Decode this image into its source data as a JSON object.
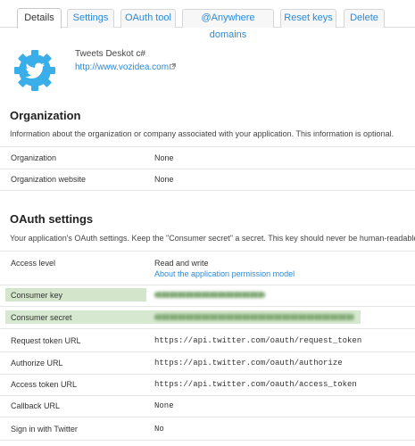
{
  "tabs": [
    {
      "label": "Details",
      "active": true
    },
    {
      "label": "Settings",
      "active": false
    },
    {
      "label": "OAuth tool",
      "active": false
    },
    {
      "label": "@Anywhere domains",
      "active": false
    },
    {
      "label": "Reset keys",
      "active": false
    },
    {
      "label": "Delete",
      "active": false
    }
  ],
  "app": {
    "name": "Tweets Deskot c#",
    "url": "http://www.vozidea.com",
    "icon": "twitter-bird-gear-icon",
    "icon_color": "#3aaee8"
  },
  "organization": {
    "heading": "Organization",
    "description": "Information about the organization or company associated with your application. This information is optional.",
    "rows": [
      {
        "label": "Organization",
        "value": "None"
      },
      {
        "label": "Organization website",
        "value": "None"
      }
    ]
  },
  "oauth": {
    "heading": "OAuth settings",
    "description": "Your application's OAuth settings. Keep the \"Consumer secret\" a secret. This key should never be human-readable in",
    "access_level": {
      "label": "Access level",
      "value": "Read and write",
      "link": "About the application permission model"
    },
    "consumer_key_label": "Consumer key",
    "consumer_secret_label": "Consumer secret",
    "rows": [
      {
        "label": "Request token URL",
        "value": "https://api.twitter.com/oauth/request_token"
      },
      {
        "label": "Authorize URL",
        "value": "https://api.twitter.com/oauth/authorize"
      },
      {
        "label": "Access token URL",
        "value": "https://api.twitter.com/oauth/access_token"
      },
      {
        "label": "Callback URL",
        "value": "None"
      },
      {
        "label": "Sign in with Twitter",
        "value": "No"
      }
    ]
  },
  "colors": {
    "link": "#2b8ad6",
    "highlight": "#d6e8cf"
  }
}
